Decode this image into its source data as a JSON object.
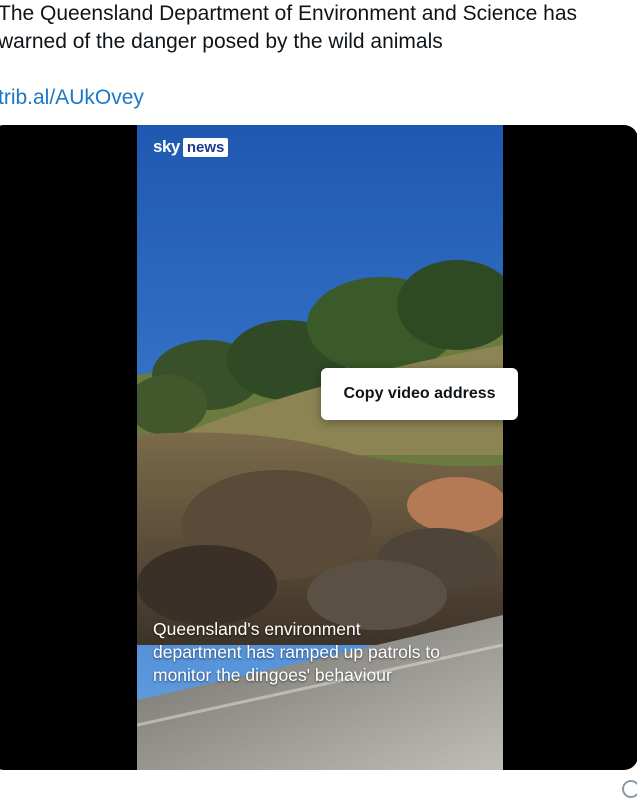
{
  "tweet": {
    "text_line1": "The Queensland Department of Environment and Science has",
    "text_line2": "warned of the danger posed by the wild animals",
    "link": "trib.al/AUkOvey"
  },
  "video": {
    "logo_sky": "sky",
    "logo_news": "news",
    "caption_line1": "Queensland's environment",
    "caption_line2": "department has ramped up patrols to",
    "caption_line3": "monitor the dingoes' behaviour"
  },
  "context_menu": {
    "items": [
      {
        "label": "Copy video address"
      }
    ]
  }
}
